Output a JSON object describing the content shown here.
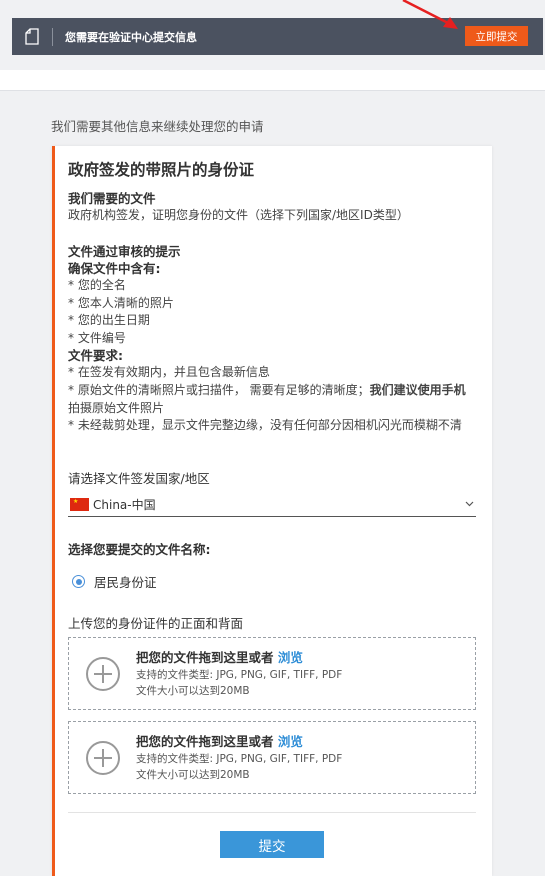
{
  "banner": {
    "message": "您需要在验证中心提交信息",
    "button_label": "立即提交",
    "icon": "document-icon"
  },
  "intro": "我们需要其他信息来继续处理您的申请",
  "card": {
    "title": "政府签发的带照片的身份证",
    "needed_heading": "我们需要的文件",
    "needed_text": "政府机构签发，证明您身份的文件（选择下列国家/地区ID类型）",
    "tips_heading": "文件通过审核的提示",
    "ensure_heading": "确保文件中含有:",
    "ensure_items": [
      "* 您的全名",
      "* 您本人清晰的照片",
      "* 您的出生日期",
      "* 文件编号"
    ],
    "req_heading": "文件要求:",
    "req_item1": "* 在签发有效期内，并且包含最新信息",
    "req_item2_a": "* 原始文件的清晰照片或扫描件， 需要有足够的清晰度；",
    "req_item2_bold": "我们建议使用手机",
    "req_item2_b": "拍摄原始文件照片",
    "req_item3": "* 未经裁剪处理，显示文件完整边缘，没有任何部分因相机闪光而模糊不清",
    "country_label": "请选择文件签发国家/地区",
    "country_value": "China-中国",
    "doc_type_label": "选择您要提交的文件名称:",
    "doc_type_option": "居民身份证",
    "upload_title": "上传您的身份证件的正面和背面",
    "dropzone": {
      "main": "把您的文件拖到这里或者",
      "link": "浏览",
      "types": "支持的文件类型: JPG, PNG, GIF, TIFF, PDF",
      "size": "文件大小可以达到20MB"
    },
    "submit_label": "提交"
  },
  "colors": {
    "accent": "#ef5a1a",
    "primary": "#3a96d9",
    "banner_bg": "#4b5260",
    "link": "#2e8dd6"
  }
}
